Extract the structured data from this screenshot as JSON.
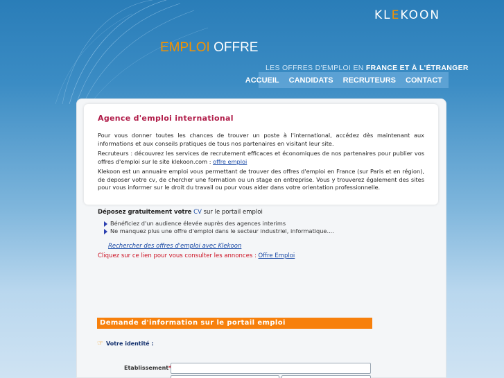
{
  "header": {
    "logo": {
      "text_main": "KL",
      "text_accent": "E",
      "text_end": "KOON"
    },
    "site_title": {
      "part1": "EMPLOI",
      "part2": " OFFRE"
    },
    "tagline": {
      "prefix": "LES OFFRES D'EMPLOI EN ",
      "highlight": "FRANCE ET À L'ÉTRANGER"
    },
    "nav": [
      "ACCUEIL",
      "CANDIDATS",
      "RECRUTEURS",
      "CONTACT"
    ]
  },
  "main": {
    "heading": "Agence d'emploi international",
    "paragraph1": "Pour vous donner toutes les chances de trouver un poste à l'international, accédez dès maintenant aux informations et aux conseils pratiques de tous nos partenaires en visitant leur site.",
    "paragraph2_text": "Recruteurs : découvrez les services de recrutement efficaces et économiques de nos partenaires pour publier vos offres d'emploi sur le site klekoon.com : ",
    "paragraph2_link": "offre emploi",
    "paragraph3": "Klekoon est un annuaire emploi vous permettant de trouver des offres d'emploi en France (sur Paris et en région), de deposer votre cv, de chercher une formation ou un stage en entreprise. Vous y trouverez également des sites pour vous informer sur le droit du travail ou pour vous aider dans votre orientation professionnelle."
  },
  "deposez": {
    "bold": "Déposez gratuitement votre",
    "cv": "CV",
    "rest": " sur le portail emploi",
    "bullets": [
      "Bénéficiez d'un audience élevée auprès des agences interims",
      "Ne manquez plus une offre d'emploi dans le secteur industriel, informatique...."
    ],
    "search_link": "Rechercher des offres d'emploi avec Klekoon",
    "click_text": "Cliquez sur ce lien pour vous consulter les annonces : ",
    "click_link": "Offre Emploi"
  },
  "form": {
    "title": "Demande d'information sur le portail emploi",
    "identity_label": "Votre identité :",
    "etablissement_label": "Etablissement",
    "required_mark": "*",
    "etablissement_value": ""
  }
}
